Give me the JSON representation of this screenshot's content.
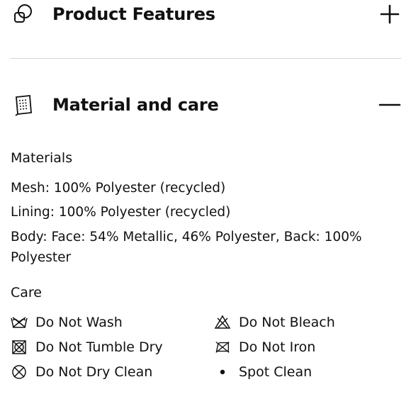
{
  "sections": {
    "features": {
      "title": "Product Features",
      "toggle": "+"
    },
    "material": {
      "title": "Material and care",
      "toggle": "−"
    }
  },
  "materials": {
    "heading": "Materials",
    "lines": [
      "Mesh: 100% Polyester (recycled)",
      "Lining: 100% Polyester (recycled)",
      "Body: Face: 54% Metallic, 46% Polyester, Back: 100%",
      "Polyester"
    ]
  },
  "care": {
    "heading": "Care",
    "items": [
      {
        "label": "Do Not Wash",
        "icon": "do-not-wash-icon"
      },
      {
        "label": "Do Not Bleach",
        "icon": "do-not-bleach-icon"
      },
      {
        "label": "Do Not Tumble Dry",
        "icon": "do-not-tumble-dry-icon"
      },
      {
        "label": "Do Not Iron",
        "icon": "do-not-iron-icon"
      },
      {
        "label": "Do Not Dry Clean",
        "icon": "do-not-dry-clean-icon"
      },
      {
        "label": "Spot Clean",
        "icon": "bullet-icon"
      }
    ]
  }
}
